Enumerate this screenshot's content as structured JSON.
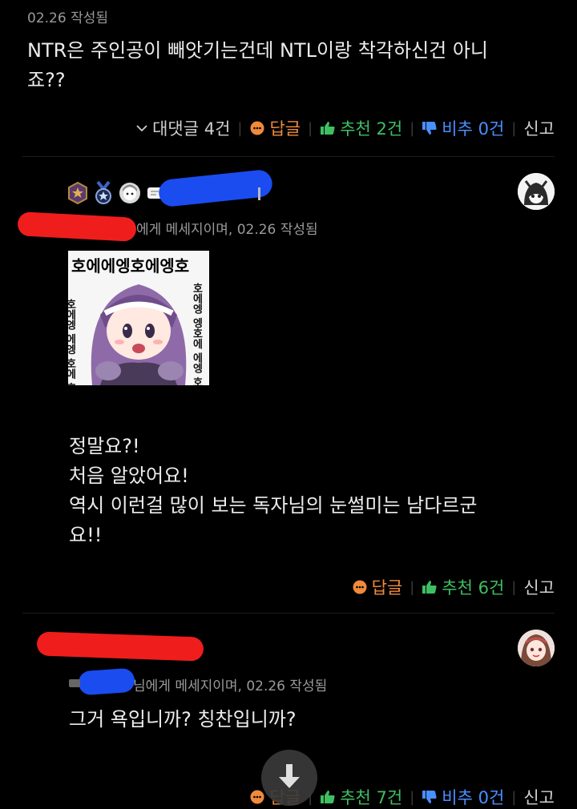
{
  "comment1": {
    "timestamp": "02.26 작성됨",
    "text_line1": "NTR은 주인공이 빼앗기는건데 NTL이랑 착각하신건 아니",
    "text_line2": "죠??",
    "actions": {
      "more_replies": "대댓글 4건",
      "reply": "답글",
      "recommend": "추천 2건",
      "dislike": "비추 0건",
      "report": "신고"
    }
  },
  "comment2": {
    "meta": "에게 메세지이며, 02.26 작성됨",
    "sticker_text_top": "호에에엥호에엥호",
    "sticker_side_left": "호에엥 에엥 호에 호에",
    "sticker_side_right": "호에엥 엥호에 에엥 호에에",
    "lines": [
      "정말요?!",
      "처음 알았어요!",
      "역시 이런걸 많이 보는 독자님의 눈썰미는 남다르군",
      "요!!"
    ],
    "actions": {
      "reply": "답글",
      "recommend": "추천 6건",
      "report": "신고"
    }
  },
  "comment3": {
    "meta": "님에게 메세지이며, 02.26 작성됨",
    "text": "그거 욕입니까? 칭찬입니까?",
    "actions": {
      "reply": "답글",
      "recommend": "추천 7건",
      "dislike": "비추 0건",
      "report": "신고"
    }
  },
  "colors": {
    "background": "#000000",
    "reply_accent": "#f08a3c",
    "recommend_accent": "#3fbf62",
    "dislike_accent": "#4a8fff",
    "redaction_red": "#f01d1d",
    "redaction_blue": "#1a4cf0"
  }
}
